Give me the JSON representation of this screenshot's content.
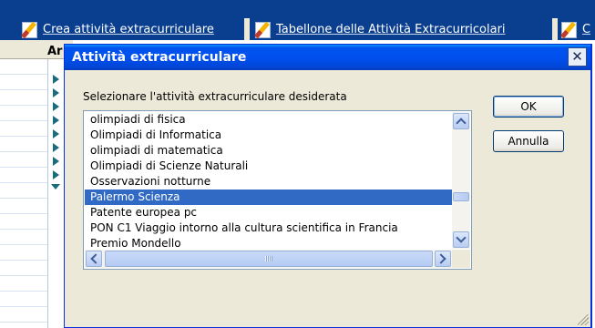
{
  "colors": {
    "tabbar": "#0a3f8f",
    "titlebar": "#0050ee",
    "selection": "#316ac5",
    "dialog_bg": "#ece9d8"
  },
  "tabs": [
    {
      "label": "Crea attività extracurriculare",
      "icon": "edit-document-icon"
    },
    {
      "label": "Tabellone delle Attività Extracurricolari",
      "icon": "edit-document-icon"
    },
    {
      "label": "C",
      "icon": "edit-document-icon"
    }
  ],
  "grid": {
    "column_header": "Ar"
  },
  "dialog": {
    "title": "Attività extracurriculare",
    "prompt": "Selezionare l'attività extracurriculare desiderata",
    "items": [
      "olimpiadi di fisica",
      "Olimpiadi di Informatica",
      "olimpiadi di matematica",
      "Olimpiadi di Scienze Naturali",
      "Osservazioni notturne",
      "Palermo Scienza",
      "Patente europea pc",
      "PON C1 Viaggio intorno alla cultura scientifica in Francia",
      "Premio Mondello"
    ],
    "selected_item": "Palermo Scienza",
    "ok_label": "OK",
    "cancel_label": "Annulla"
  }
}
